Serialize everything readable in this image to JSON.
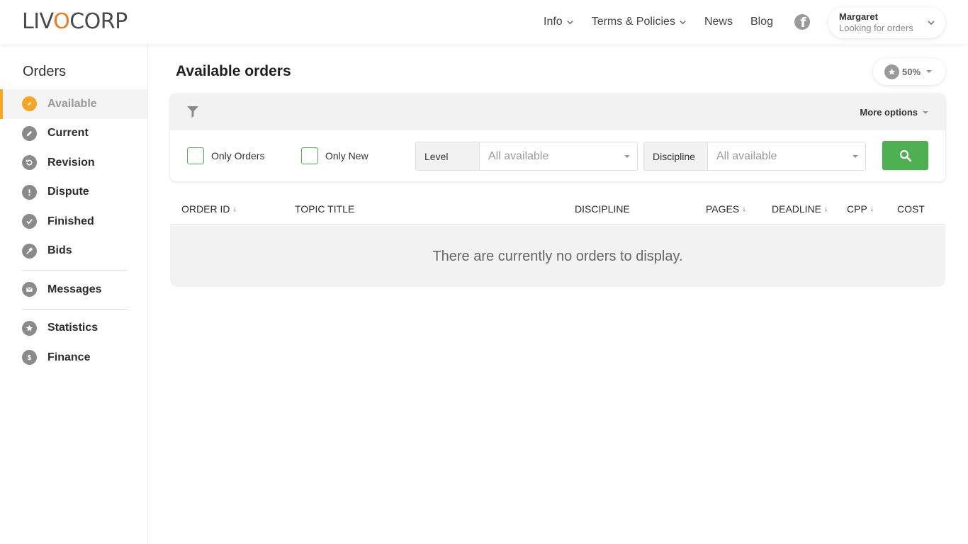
{
  "header": {
    "logo": {
      "part1": "LIV",
      "o": "O",
      "part2": "CORP"
    },
    "nav": [
      {
        "label": "Info"
      },
      {
        "label": "Terms & Policies"
      },
      {
        "label": "News"
      },
      {
        "label": "Blog"
      }
    ],
    "user": {
      "name": "Margaret",
      "status": "Looking for orders"
    }
  },
  "sidebar": {
    "title": "Orders",
    "items": [
      {
        "label": "Available",
        "icon": "compass-icon",
        "active": true
      },
      {
        "label": "Current",
        "icon": "pencil-icon"
      },
      {
        "label": "Revision",
        "icon": "revision-icon"
      },
      {
        "label": "Dispute",
        "icon": "alert-icon"
      },
      {
        "label": "Finished",
        "icon": "check-icon"
      },
      {
        "label": "Bids",
        "icon": "gavel-icon"
      },
      {
        "label": "Messages",
        "icon": "envelope-icon"
      },
      {
        "label": "Statistics",
        "icon": "star-icon"
      },
      {
        "label": "Finance",
        "icon": "dollar-icon"
      }
    ]
  },
  "main": {
    "title": "Available orders",
    "rating": "50%",
    "filters": {
      "more_options": "More options",
      "only_orders": "Only Orders",
      "only_new": "Only New",
      "level": {
        "label": "Level",
        "value": "All available"
      },
      "discipline": {
        "label": "Discipline",
        "value": "All available"
      }
    },
    "table": {
      "columns": [
        "ORDER ID",
        "TOPIC TITLE",
        "DISCIPLINE",
        "PAGES",
        "DEADLINE",
        "CPP",
        "COST"
      ],
      "empty_message": "There are currently no orders to display."
    }
  },
  "colors": {
    "accent": "#f5a623",
    "brand": "#f07a1c",
    "primary_button": "#4caf50"
  }
}
